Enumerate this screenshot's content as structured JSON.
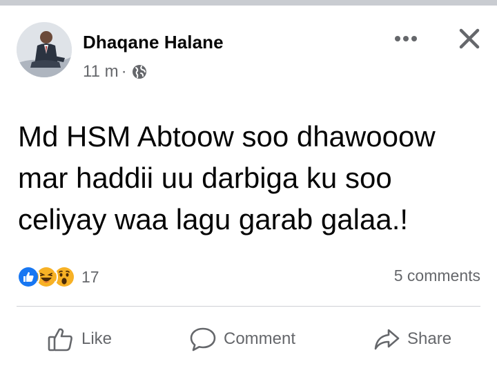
{
  "post": {
    "author": "Dhaqane Halane",
    "time": "11 m",
    "separator": "·",
    "audience_icon": "globe-icon",
    "text_lines": [
      "Md HSM Abtoow soo dhawooow",
      "mar haddii uu darbiga ku soo",
      "celiyay waa lagu garab galaa.!"
    ]
  },
  "header": {
    "more_icon": "more-horizontal-icon",
    "close_icon": "close-icon"
  },
  "reactions": {
    "types": [
      "like",
      "haha",
      "wow"
    ],
    "count": "17",
    "colors": {
      "like": "#1877f2",
      "haha": "#f7b125",
      "wow": "#f7b125"
    }
  },
  "comments": {
    "label": "5 comments"
  },
  "actions": {
    "like": "Like",
    "comment": "Comment",
    "share": "Share"
  },
  "colors": {
    "text": "#050505",
    "secondary": "#65676b",
    "divider": "#ced0d4",
    "accent": "#1877f2"
  }
}
